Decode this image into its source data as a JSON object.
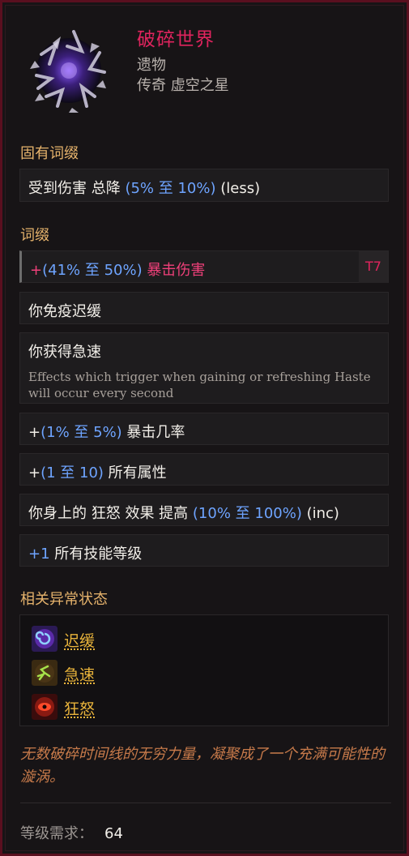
{
  "item": {
    "name": "破碎世界",
    "type": "遗物",
    "base": "传奇 虚空之星",
    "icon": "void-star-relic-icon"
  },
  "sections": {
    "implicit_title": "固有词缀",
    "affix_title": "词缀",
    "status_title": "相关异常状态"
  },
  "implicit": {
    "prefix": "受到伤害 总降 ",
    "range": "(5% 至 10%)",
    "suffix": " (less)"
  },
  "affixes": {
    "crit_damage": {
      "plus": "+",
      "range": "(41% 至 50%)",
      "label": " 暴击伤害",
      "tier": "T7"
    },
    "slow_immune": {
      "text": "你免疫迟缓"
    },
    "haste": {
      "title": "你获得急速",
      "desc": "Effects which trigger when gaining or refreshing Haste will occur every second"
    },
    "crit_chance": {
      "plus": "+",
      "range": "(1% 至 5%)",
      "label": " 暴击几率"
    },
    "attributes": {
      "plus": "+",
      "range": "(1 至 10)",
      "label": " 所有属性"
    },
    "rage": {
      "prefix": "你身上的 狂怒 效果 提高 ",
      "range": "(10% 至 100%)",
      "suffix": " (inc)"
    },
    "skill_level": {
      "value": "+1",
      "label": " 所有技能等级"
    }
  },
  "statuses": [
    {
      "label": "迟缓",
      "icon": "slow-spiral-icon",
      "color": "#6a5cff"
    },
    {
      "label": "急速",
      "icon": "haste-runner-icon",
      "color": "#7fbf3a"
    },
    {
      "label": "狂怒",
      "icon": "rage-eye-icon",
      "color": "#d62a1a"
    }
  ],
  "flavor": "无数破碎时间线的无穷力量，凝聚成了一个充满可能性的漩涡。",
  "requirement": {
    "label": "等级需求：",
    "value": "64"
  },
  "colors": {
    "border": "#5a0f1f",
    "name": "#e0245e",
    "section": "#e6b36c",
    "range": "#6ea4ff",
    "status_link": "#e8b33b",
    "flavor": "#c77a4a"
  }
}
